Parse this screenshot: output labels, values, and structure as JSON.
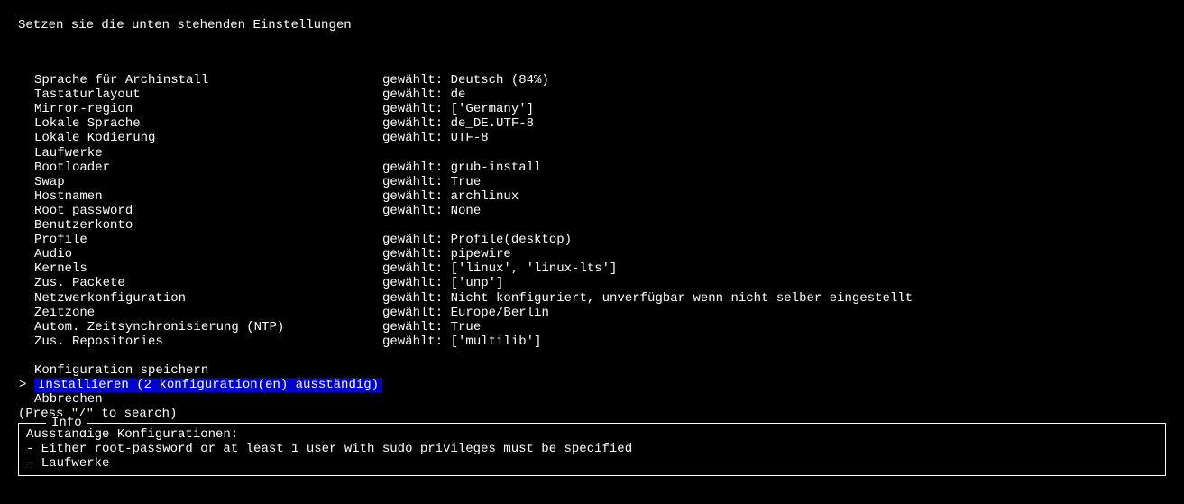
{
  "header": {
    "title": "Setzen sie die unten stehenden Einstellungen"
  },
  "menu": {
    "chosen_prefix": "gewählt: ",
    "items": [
      {
        "label": "Sprache für Archinstall",
        "value": "Deutsch (84%)"
      },
      {
        "label": "Tastaturlayout",
        "value": "de"
      },
      {
        "label": "Mirror-region",
        "value": "['Germany']"
      },
      {
        "label": "Lokale Sprache",
        "value": "de_DE.UTF-8"
      },
      {
        "label": "Lokale Kodierung",
        "value": "UTF-8"
      },
      {
        "label": "Laufwerke",
        "value": ""
      },
      {
        "label": "Bootloader",
        "value": "grub-install"
      },
      {
        "label": "Swap",
        "value": "True"
      },
      {
        "label": "Hostnamen",
        "value": "archlinux"
      },
      {
        "label": "Root password",
        "value": "None"
      },
      {
        "label": "Benutzerkonto",
        "value": ""
      },
      {
        "label": "Profile",
        "value": "Profile(desktop)"
      },
      {
        "label": "Audio",
        "value": "pipewire"
      },
      {
        "label": "Kernels",
        "value": "['linux', 'linux-lts']"
      },
      {
        "label": "Zus. Packete",
        "value": "['unp']"
      },
      {
        "label": "Netzwerkonfiguration",
        "value": "Nicht konfiguriert, unverfügbar wenn nicht selber eingestellt"
      },
      {
        "label": "Zeitzone",
        "value": "Europe/Berlin"
      },
      {
        "label": "Autom. Zeitsynchronisierung (NTP)",
        "value": "True"
      },
      {
        "label": "Zus. Repositories",
        "value": "['multilib']"
      }
    ]
  },
  "actions": {
    "save": "Konfiguration speichern",
    "install": "Installieren (2 konfiguration(en) ausständig)",
    "cancel": "Abbrechen"
  },
  "selector": ">",
  "search_hint": "(Press \"/\" to search)",
  "info": {
    "title": "Info",
    "heading": "Ausständige Konfigurationen:",
    "line1": "- Either root-password or at least 1 user with sudo privileges must be specified",
    "line2": "- Laufwerke"
  }
}
